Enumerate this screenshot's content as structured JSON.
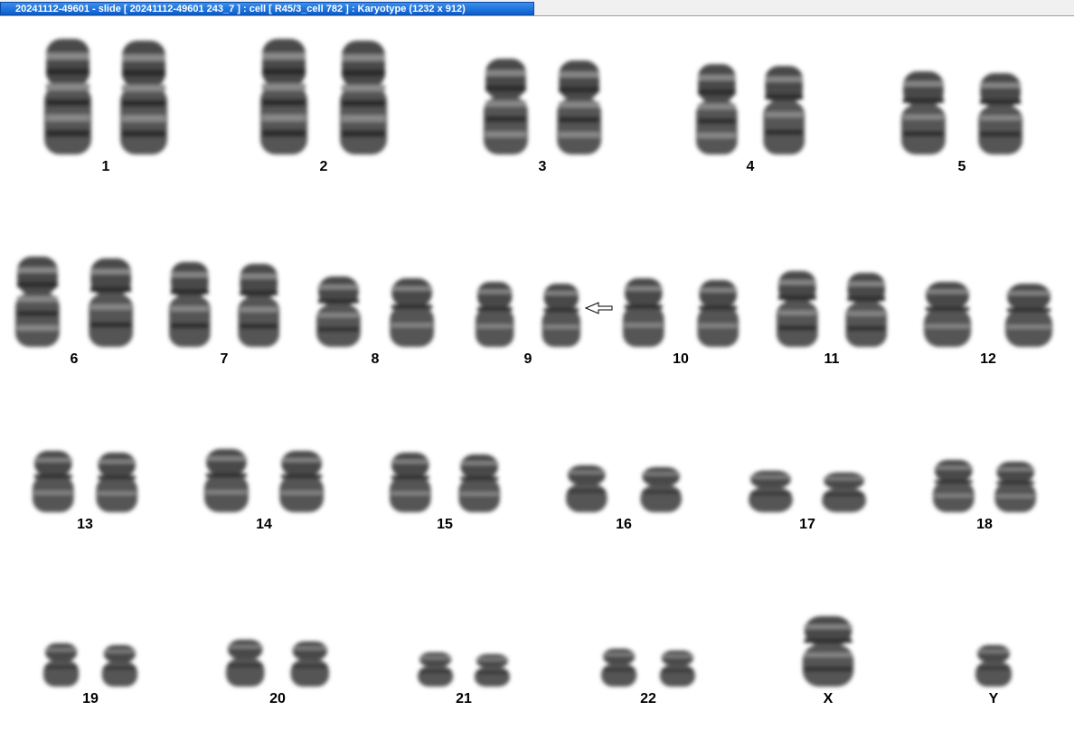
{
  "window": {
    "title": "20241112-49601 - slide [ 20241112-49601 243_7 ] : cell [ R45/3_cell 782 ] : Karyotype  (1232 x 912)"
  },
  "colors": {
    "title_bg": "#0a5fd0",
    "chromosome": "#3a3a3a"
  },
  "chromosomes": [
    {
      "label": "1"
    },
    {
      "label": "2"
    },
    {
      "label": "3"
    },
    {
      "label": "4"
    },
    {
      "label": "5"
    },
    {
      "label": "6"
    },
    {
      "label": "7"
    },
    {
      "label": "8"
    },
    {
      "label": "9"
    },
    {
      "label": "10"
    },
    {
      "label": "11"
    },
    {
      "label": "12"
    },
    {
      "label": "13"
    },
    {
      "label": "14"
    },
    {
      "label": "15"
    },
    {
      "label": "16"
    },
    {
      "label": "17"
    },
    {
      "label": "18"
    },
    {
      "label": "19"
    },
    {
      "label": "20"
    },
    {
      "label": "21"
    },
    {
      "label": "22"
    },
    {
      "label": "X"
    },
    {
      "label": "Y"
    }
  ],
  "annotation": {
    "icon": "arrow-left-icon",
    "target": "9"
  }
}
